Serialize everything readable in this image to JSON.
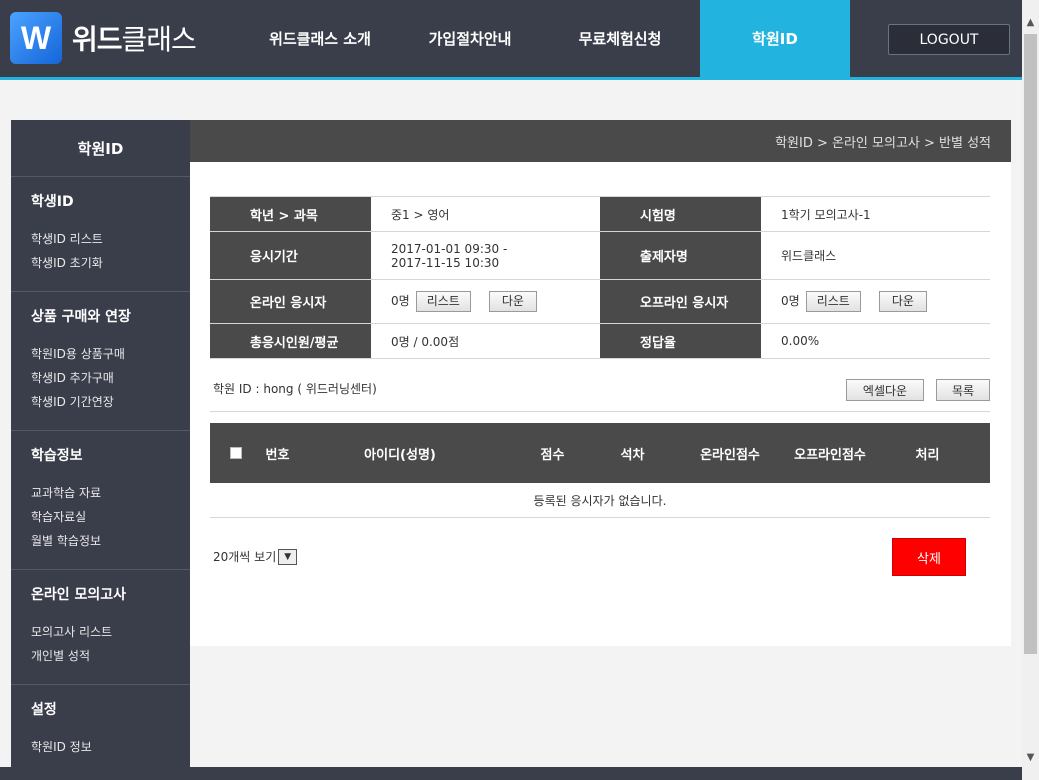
{
  "header": {
    "logo_letter": "W",
    "logo_bold": "위드",
    "logo_thin": "클래스",
    "nav": [
      "위드클래스 소개",
      "가입절차안내",
      "무료체험신청",
      "학원ID"
    ],
    "logout": "LOGOUT"
  },
  "sidebar": {
    "title": "학원ID",
    "sections": [
      {
        "title": "학생ID",
        "links": [
          "학생ID 리스트",
          "학생ID 초기화"
        ]
      },
      {
        "title": "상품 구매와 연장",
        "links": [
          "학원ID용 상품구매",
          "학생ID 추가구매",
          "학생ID 기간연장"
        ]
      },
      {
        "title": "학습정보",
        "links": [
          "교과학습 자료",
          "학습자료실",
          "월별 학습정보"
        ]
      },
      {
        "title": "온라인 모의고사",
        "links": [
          "모의고사 리스트",
          "개인별 성적"
        ]
      },
      {
        "title": "설정",
        "links": [
          "학원ID 정보"
        ]
      }
    ]
  },
  "content": {
    "breadcrumb": "학원ID > 온라인 모의고사 > 반별 성적",
    "info": {
      "grade_subject_label": "학년 > 과목",
      "grade_subject_value": "중1 > 영어",
      "exam_name_label": "시험명",
      "exam_name_value": "1학기 모의고사-1",
      "period_label": "응시기간",
      "period_start": "2017-01-01 09:30 -",
      "period_end": "2017-11-15 10:30",
      "author_label": "출제자명",
      "author_value": "위드클래스",
      "online_label": "온라인 응시자",
      "online_count": "0명",
      "offline_label": "오프라인 응시자",
      "offline_count": "0명",
      "list_btn": "리스트",
      "down_btn": "다운",
      "total_label": "총응시인원/평균",
      "total_value": "0명 / 0.00점",
      "accuracy_label": "정답율",
      "accuracy_value": "0.00%"
    },
    "academy_line": "학원 ID : hong ( 위드러닝센터)",
    "excel_btn": "엑셀다운",
    "list_btn": "목록",
    "columns": [
      "번호",
      "아이디(성명)",
      "점수",
      "석차",
      "온라인점수",
      "오프라인점수",
      "처리"
    ],
    "empty_message": "등록된 응시자가 없습니다.",
    "page_size_label": "20개씩 보기",
    "delete_btn": "삭제"
  }
}
